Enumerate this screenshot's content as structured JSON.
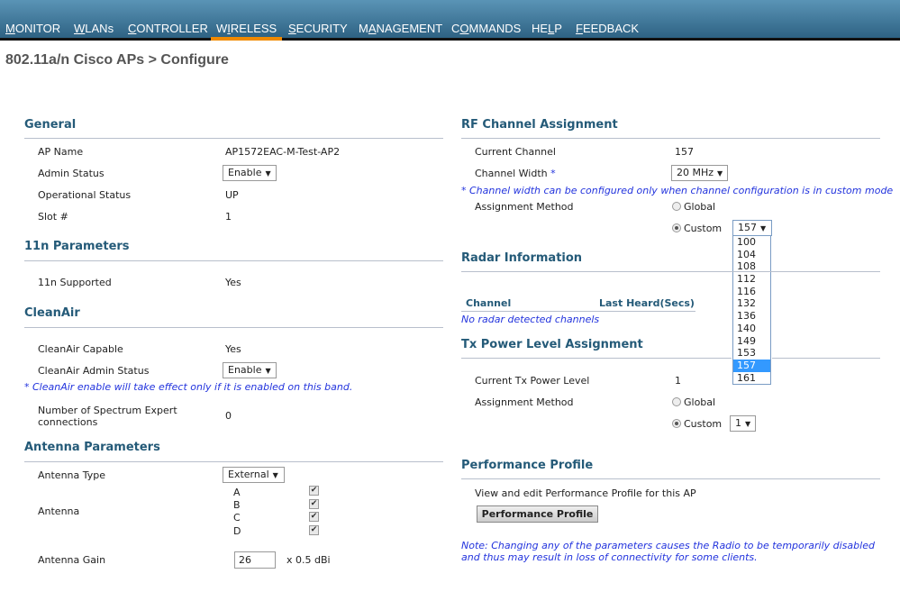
{
  "nav": [
    {
      "label": "MONITOR",
      "key": "M",
      "rest": "ONITOR"
    },
    {
      "label": "WLANs",
      "key": "W",
      "rest": "LANs"
    },
    {
      "label": "CONTROLLER",
      "key": "C",
      "rest": "ONTROLLER"
    },
    {
      "label": "WIRELESS",
      "pre": "W",
      "key": "I",
      "rest": "RELESS",
      "active": true
    },
    {
      "label": "SECURITY",
      "key": "S",
      "rest": "ECURITY"
    },
    {
      "label": "MANAGEMENT",
      "pre": "M",
      "key": "A",
      "rest": "NAGEMENT"
    },
    {
      "label": "COMMANDS",
      "pre": "C",
      "key": "O",
      "rest": "MMANDS"
    },
    {
      "label": "HELP",
      "pre": "HE",
      "key": "L",
      "rest": "P"
    },
    {
      "label": "FEEDBACK",
      "key": "F",
      "rest": "EEDBACK"
    }
  ],
  "page_title": "802.11a/n Cisco APs > Configure",
  "general": {
    "heading": "General",
    "ap_name_label": "AP Name",
    "ap_name": "AP1572EAC-M-Test-AP2",
    "admin_status_label": "Admin Status",
    "admin_status": "Enable",
    "oper_status_label": "Operational Status",
    "oper_status": "UP",
    "slot_label": "Slot #",
    "slot": "1"
  },
  "n11": {
    "heading": "11n Parameters",
    "supported_label": "11n Supported",
    "supported": "Yes"
  },
  "cleanair": {
    "heading": "CleanAir",
    "capable_label": "CleanAir Capable",
    "capable": "Yes",
    "admin_label": "CleanAir Admin Status",
    "admin": "Enable",
    "note": "* CleanAir enable will take effect only if it is enabled on this band.",
    "spectrum_label_1": "Number of Spectrum Expert",
    "spectrum_label_2": "connections",
    "spectrum": "0"
  },
  "antenna": {
    "heading": "Antenna Parameters",
    "type_label": "Antenna Type",
    "type": "External",
    "antenna_label": "Antenna",
    "antennas": [
      {
        "name": "A",
        "checked": true
      },
      {
        "name": "B",
        "checked": true
      },
      {
        "name": "C",
        "checked": true
      },
      {
        "name": "D",
        "checked": true
      }
    ],
    "gain_label": "Antenna Gain",
    "gain": "26",
    "gain_unit": "x 0.5 dBi"
  },
  "rf": {
    "heading": "RF Channel Assignment",
    "current_label": "Current Channel",
    "current": "157",
    "width_label": "Channel Width",
    "width_star": "*",
    "width": "20 MHz",
    "note": "* Channel width can be configured only when channel configuration is in custom mode",
    "method_label": "Assignment Method",
    "global": "Global",
    "custom": "Custom",
    "custom_value": "157",
    "options": [
      "100",
      "104",
      "108",
      "112",
      "116",
      "132",
      "136",
      "140",
      "149",
      "153",
      "157",
      "161"
    ],
    "selected": "157"
  },
  "radar": {
    "heading": "Radar Information",
    "col_channel": "Channel",
    "col_heard": "Last Heard(Secs)",
    "empty": "No radar detected channels"
  },
  "tx": {
    "heading": "Tx Power Level Assignment",
    "current_label": "Current Tx Power Level",
    "current": "1",
    "method_label": "Assignment Method",
    "global": "Global",
    "custom": "Custom",
    "custom_value": "1"
  },
  "perf": {
    "heading": "Performance Profile",
    "text": "View and edit Performance Profile for this AP",
    "button": "Performance Profile",
    "note_1": "Note: Changing any of the parameters causes the Radio to be temporarily disabled",
    "note_2": "and thus may result in loss of connectivity for some clients."
  }
}
